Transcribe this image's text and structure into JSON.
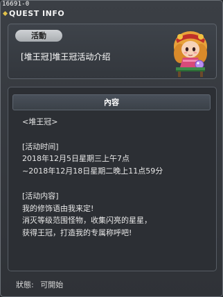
{
  "quest_id": "16691-0",
  "window_title": "QUEST INFO",
  "header": {
    "category": "活動",
    "quest_name": "[堆王冠]堆王冠活动介绍"
  },
  "content": {
    "header_label": "內容",
    "lines": [
      "<堆王冠>",
      "",
      "[活动时间]",
      "2018年12月5日星期三上午7点",
      "~2018年12月18日星期二晚上11点59分",
      "",
      "[活动内容]",
      "我的修饰语由我来定!",
      "消灭等级范围怪物，收集闪亮的星星，",
      "获得王冠，打造我的专属称呼吧!"
    ]
  },
  "status": {
    "label": "狀態:",
    "value": "可開始"
  }
}
